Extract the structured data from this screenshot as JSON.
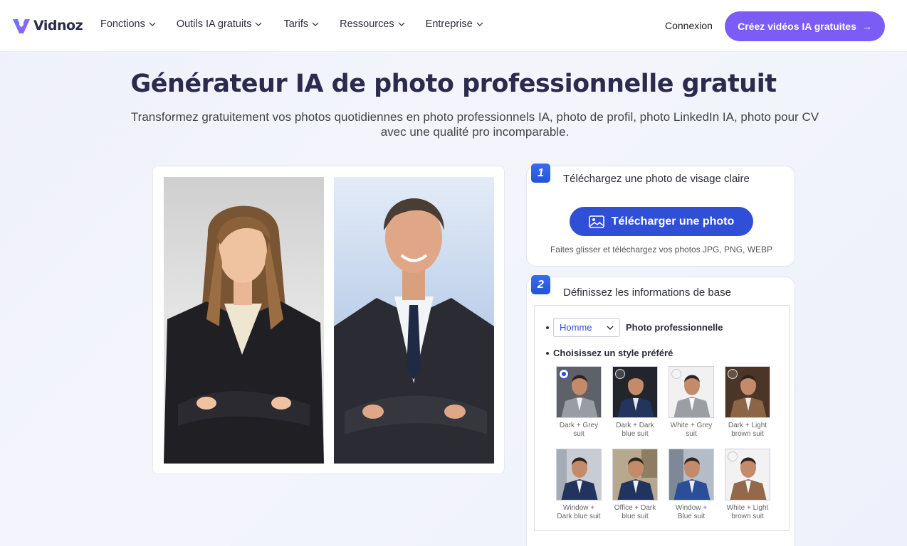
{
  "brand": {
    "name": "Vidnoz",
    "accent": "#7b5cf5",
    "primary_blue": "#2f4fd6"
  },
  "nav": {
    "items": [
      {
        "label": "Fonctions"
      },
      {
        "label": "Outils IA gratuits"
      },
      {
        "label": "Tarifs"
      },
      {
        "label": "Ressources"
      },
      {
        "label": "Entreprise"
      }
    ],
    "login": "Connexion",
    "cta": "Créez vidéos IA gratuites",
    "cta_icon": "arrow-right-icon"
  },
  "hero": {
    "title": "Générateur IA de photo professionnelle gratuit",
    "subtitle": "Transformez gratuitement vos photos quotidiennes en photo professionnels IA, photo de profil, photo LinkedIn IA, photo pour CV avec une qualité pro incomparable."
  },
  "step1": {
    "number": "1",
    "title": "Téléchargez une photo de visage claire",
    "button": "Télécharger une photo",
    "button_icon": "image-upload-icon",
    "hint": "Faites glisser et téléchargez vos photos JPG, PNG, WEBP"
  },
  "step2": {
    "number": "2",
    "title": "Définissez les informations de base",
    "gender_select": "Homme",
    "photo_type": "Photo professionnelle",
    "style_heading": "Choisissez un style préféré",
    "styles": [
      {
        "label": "Dark + Grey suit",
        "selected": true
      },
      {
        "label": "Dark + Dark blue suit",
        "selected": false
      },
      {
        "label": "White + Grey suit",
        "selected": false
      },
      {
        "label": "Dark + Light brown suit",
        "selected": false
      },
      {
        "label": "Window + Dark blue suit",
        "selected": false
      },
      {
        "label": "Office + Dark blue suit",
        "selected": false
      },
      {
        "label": "Window + Blue suit",
        "selected": false
      },
      {
        "label": "White + Light brown suit",
        "selected": false
      }
    ]
  }
}
